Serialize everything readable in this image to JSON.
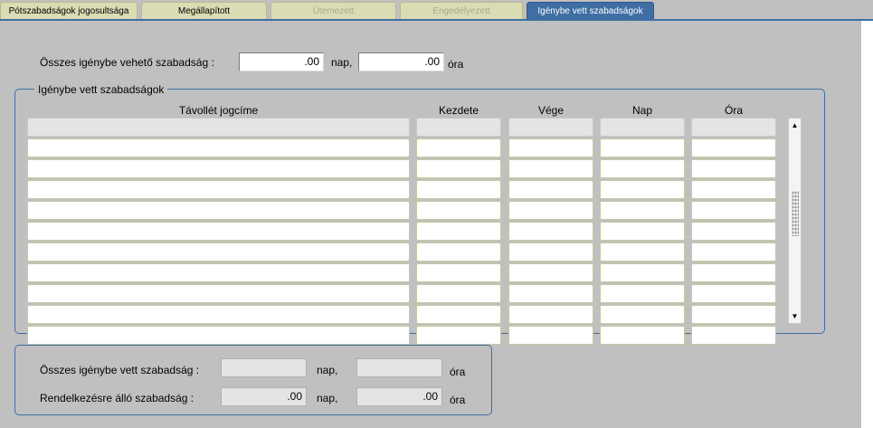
{
  "tabs": [
    {
      "label": "Pótszabadságok jogosultsága",
      "state": "normal"
    },
    {
      "label": "Megállapított",
      "state": "normal"
    },
    {
      "label": "Ütemezett",
      "state": "disabled"
    },
    {
      "label": "Engedélyezett",
      "state": "disabled"
    },
    {
      "label": "Igénybe vett szabadságok",
      "state": "active"
    }
  ],
  "top": {
    "label": "Összes igénybe vehető szabadság :",
    "nap_value": ".00",
    "nap_unit": "nap,",
    "ora_value": ".00",
    "ora_unit": "óra"
  },
  "group": {
    "title": "Igénybe vett szabadságok",
    "columns": [
      "Távollét jogcíme",
      "Kezdete",
      "Vége",
      "Nap",
      "Óra"
    ],
    "rows": [
      [
        "",
        "",
        "",
        "",
        ""
      ],
      [
        "",
        "",
        "",
        "",
        ""
      ],
      [
        "",
        "",
        "",
        "",
        ""
      ],
      [
        "",
        "",
        "",
        "",
        ""
      ],
      [
        "",
        "",
        "",
        "",
        ""
      ],
      [
        "",
        "",
        "",
        "",
        ""
      ],
      [
        "",
        "",
        "",
        "",
        ""
      ],
      [
        "",
        "",
        "",
        "",
        ""
      ],
      [
        "",
        "",
        "",
        "",
        ""
      ],
      [
        "",
        "",
        "",
        "",
        ""
      ]
    ]
  },
  "summary": {
    "used_label": "Összes igénybe vett szabadság :",
    "used_nap": "",
    "used_nap_unit": "nap,",
    "used_ora": "",
    "used_ora_unit": "óra",
    "avail_label": "Rendelkezésre álló szabadság :",
    "avail_nap": ".00",
    "avail_nap_unit": "nap,",
    "avail_ora": ".00",
    "avail_ora_unit": "óra"
  },
  "icons": {
    "scroll_up": "arrow-up-icon",
    "scroll_down": "arrow-down-icon"
  },
  "colors": {
    "accent": "#3e6ea3",
    "tab": "#dcdcb4",
    "background": "#c0c0c0"
  }
}
